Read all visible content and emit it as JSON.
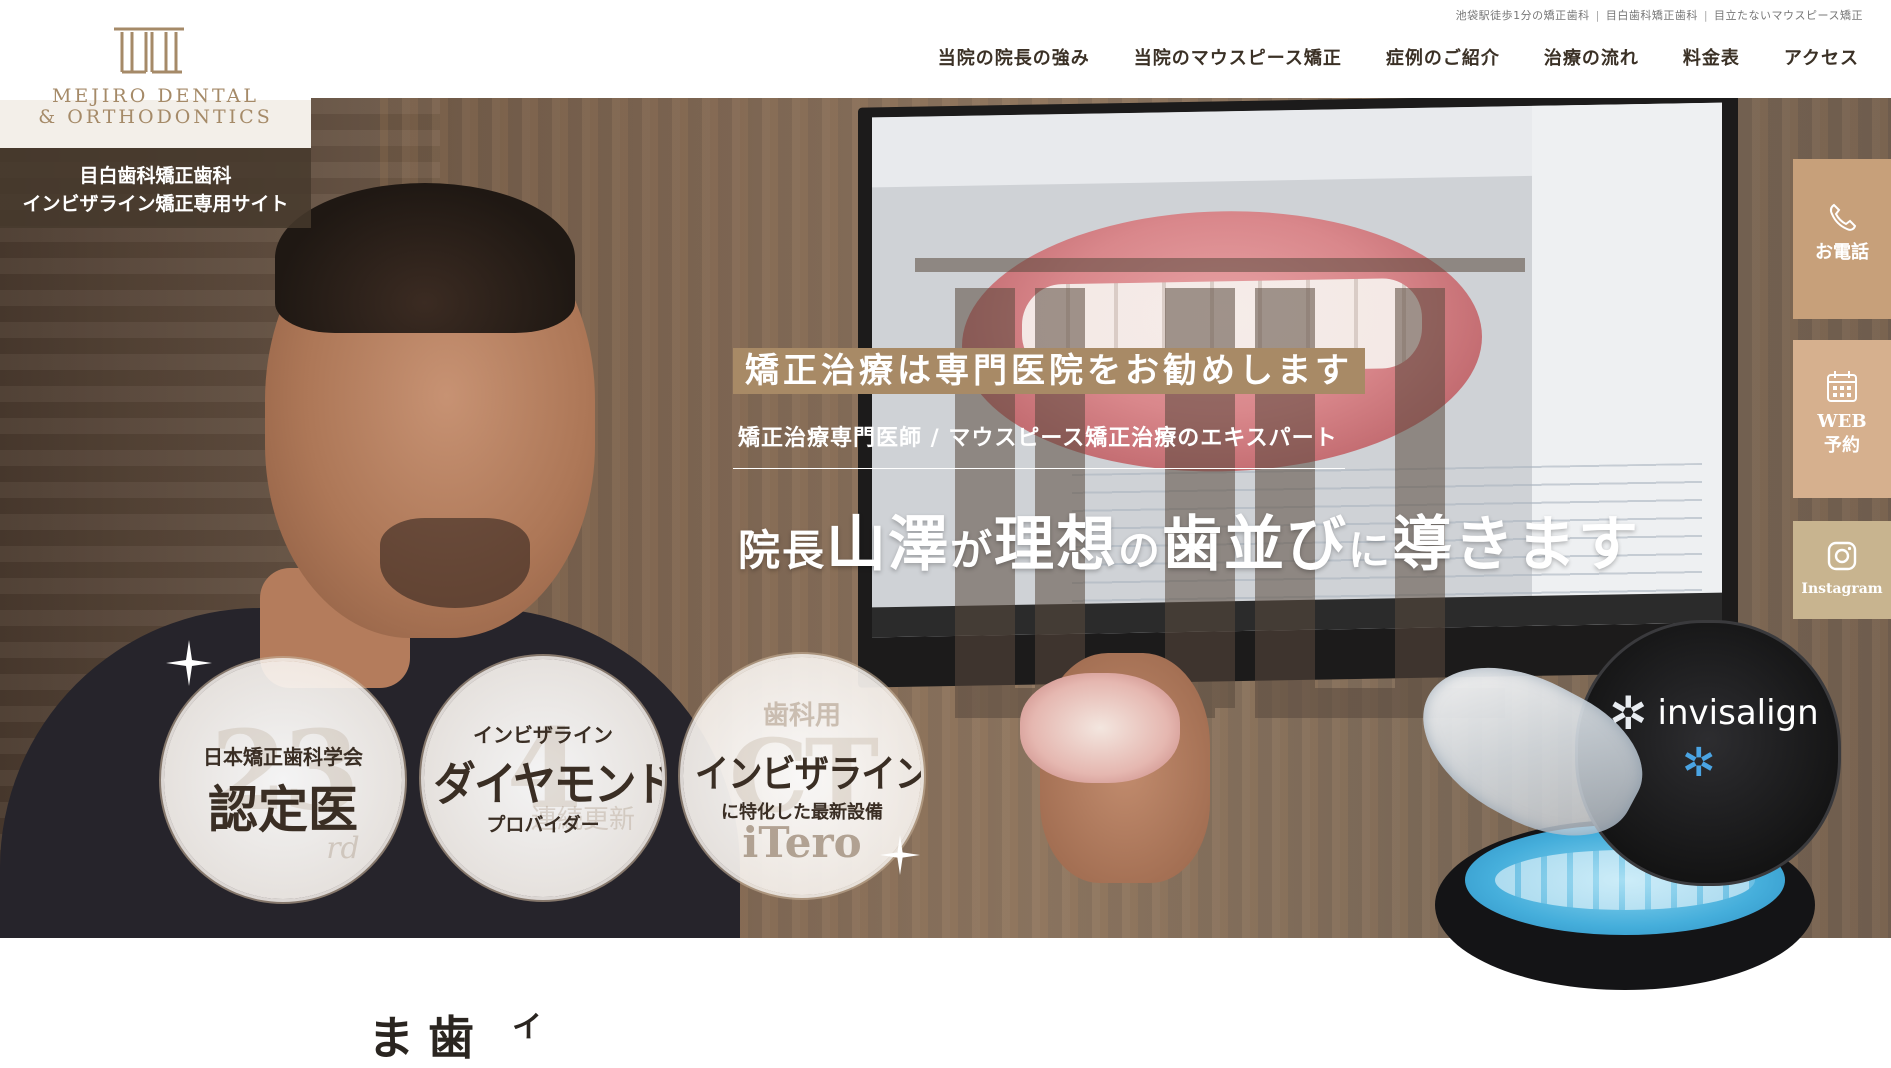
{
  "logo": {
    "line1": "MEJIRO DENTAL",
    "line2": "& ORTHODONTICS",
    "tagline_line1": "目白歯科矯正歯科",
    "tagline_line2": "インビザライン矯正専用サイト"
  },
  "top_links": [
    "池袋駅徒歩1分の矯正歯科",
    "目白歯科矯正歯科",
    "目立たないマウスピース矯正"
  ],
  "nav": [
    "当院の院長の強み",
    "当院のマウスピース矯正",
    "症例のご紹介",
    "治療の流れ",
    "料金表",
    "アクセス"
  ],
  "hero": {
    "label": "矯正治療は専門医院をお勧めします",
    "subtitle": "矯正治療専門医師 / マウスピース矯正治療のエキスパート",
    "headline": {
      "p1": "院長",
      "p2": "山澤",
      "p3": "が",
      "p4": "理想",
      "p5": "の",
      "p6": "歯並び",
      "p7": "に",
      "p8": "導きます"
    }
  },
  "badges": [
    {
      "bg": "23",
      "bg_sub": "rd",
      "line1": "日本矯正歯科学会",
      "line2": "認定医"
    },
    {
      "bg": "4",
      "bg_sub": "連続更新",
      "line1": "インビザライン",
      "line2": "ダイヤモンド",
      "line3": "プロバイダー"
    },
    {
      "top": "歯科用",
      "bg": "CT",
      "line1": "インビザライン",
      "line2": "に特化した最新設備",
      "line3": "iTero"
    }
  ],
  "product": {
    "brand": "invisalign"
  },
  "side_buttons": {
    "phone": "お電話",
    "web_line1": "WEB",
    "web_line2": "予約",
    "instagram": "Instagram"
  },
  "section_peek": {
    "text": "ま歯",
    "small": "イ"
  },
  "colors": {
    "accent_gold": "#a88a66",
    "phone_bg": "#c7a07a",
    "web_bg": "#d6b08e",
    "insta_bg": "#c8b48f",
    "logo_text": "#a58a68"
  }
}
